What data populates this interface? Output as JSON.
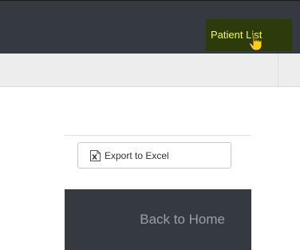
{
  "navbar": {
    "link_label": "Patient List",
    "cursor_icon": "hand-pointer-icon",
    "background": "#343a40",
    "highlight_background": "#2c3b09",
    "highlight_text": "#f4ff2b"
  },
  "toolbar": {
    "export_label": "Export to Excel",
    "export_icon": "excel-file-icon"
  },
  "panel": {
    "back_label": "Back to Home",
    "background": "#343a40"
  }
}
